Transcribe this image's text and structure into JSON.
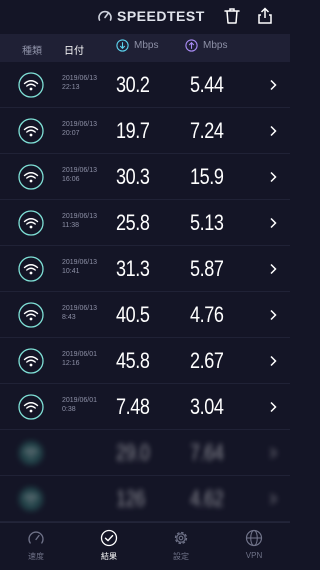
{
  "app": {
    "title": "SPEEDTEST"
  },
  "header": {
    "type_label": "種類",
    "date_label": "日付",
    "download_unit": "Mbps",
    "upload_unit": "Mbps"
  },
  "results": [
    {
      "date": "2019/06/13",
      "time": "22:13",
      "download": "30.2",
      "upload": "5.44"
    },
    {
      "date": "2019/06/13",
      "time": "20:07",
      "download": "19.7",
      "upload": "7.24"
    },
    {
      "date": "2019/06/13",
      "time": "16:06",
      "download": "30.3",
      "upload": "15.9"
    },
    {
      "date": "2019/06/13",
      "time": "11:38",
      "download": "25.8",
      "upload": "5.13"
    },
    {
      "date": "2019/06/13",
      "time": "10:41",
      "download": "31.3",
      "upload": "5.87"
    },
    {
      "date": "2019/06/13",
      "time": "8:43",
      "download": "40.5",
      "upload": "4.76"
    },
    {
      "date": "2019/06/01",
      "time": "12:16",
      "download": "45.8",
      "upload": "2.67"
    },
    {
      "date": "2019/06/01",
      "time": "0:38",
      "download": "7.48",
      "upload": "3.04"
    },
    {
      "date": "",
      "time": "",
      "download": "29.0",
      "upload": "7.64"
    },
    {
      "date": "",
      "time": "",
      "download": "126",
      "upload": "4.62"
    }
  ],
  "tabs": [
    {
      "label": "速度",
      "icon": "speedometer-icon"
    },
    {
      "label": "結果",
      "icon": "checkmark-circle-icon"
    },
    {
      "label": "設定",
      "icon": "gear-icon"
    },
    {
      "label": "VPN",
      "icon": "globe-icon"
    }
  ],
  "colors": {
    "background": "#141526",
    "header_bar": "#1f2035",
    "wifi_accent": "#7fe0d6",
    "download_accent": "#5cd3ee",
    "upload_accent": "#a98cf5"
  }
}
